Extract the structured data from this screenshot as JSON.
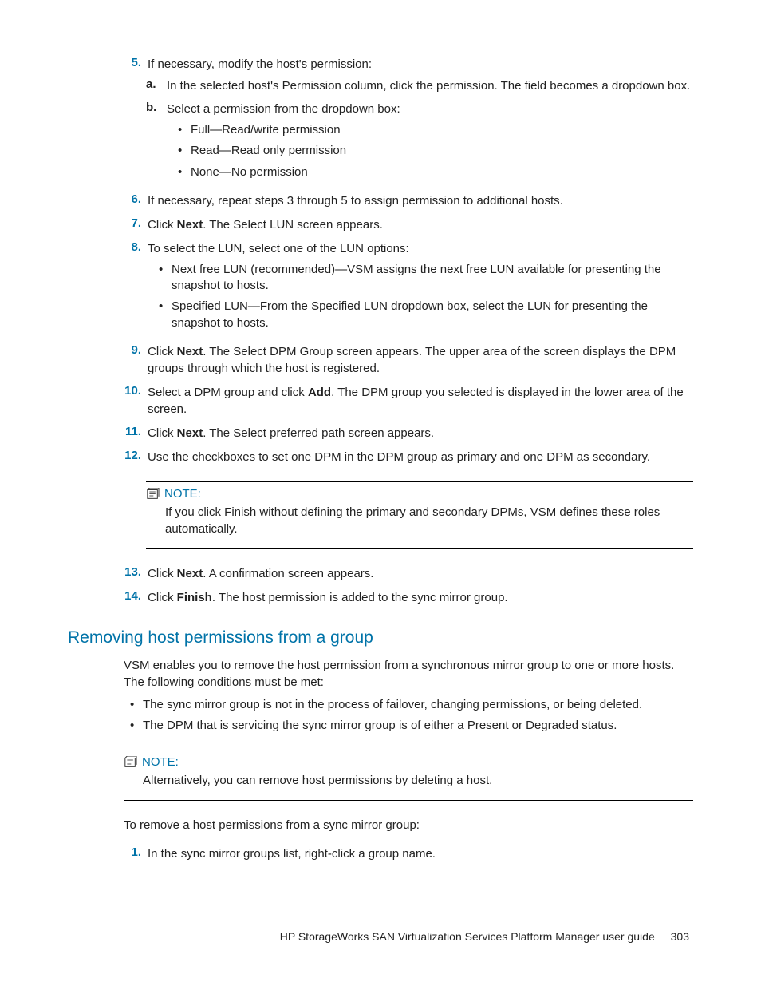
{
  "steps": {
    "s5": {
      "num": "5.",
      "text": "If necessary, modify the host's permission:"
    },
    "s5a": {
      "num": "a.",
      "text": "In the selected host's Permission column, click the permission. The field becomes a dropdown box."
    },
    "s5b": {
      "num": "b.",
      "text": "Select a permission from the dropdown box:"
    },
    "s5b_opts": {
      "o1": "Full—Read/write permission",
      "o2": "Read—Read only permission",
      "o3": "None—No permission"
    },
    "s6": {
      "num": "6.",
      "text": "If necessary, repeat steps 3 through 5 to assign permission to additional hosts."
    },
    "s7": {
      "num": "7.",
      "pre": "Click ",
      "bold": "Next",
      "post": ". The Select LUN screen appears."
    },
    "s8": {
      "num": "8.",
      "text": "To select the LUN, select one of the LUN options:"
    },
    "s8_opts": {
      "o1": "Next free LUN (recommended)—VSM assigns the next free LUN available for presenting the snapshot to hosts.",
      "o2": "Specified LUN—From the Specified LUN dropdown box, select the LUN for presenting the snapshot to hosts."
    },
    "s9": {
      "num": "9.",
      "pre": "Click ",
      "bold": "Next",
      "post": ". The Select DPM Group screen appears. The upper area of the screen displays the DPM groups through which the host is registered."
    },
    "s10": {
      "num": "10.",
      "pre": "Select a DPM group and click ",
      "bold": "Add",
      "post": ". The DPM group you selected is displayed in the lower area of the screen."
    },
    "s11": {
      "num": "11.",
      "pre": "Click ",
      "bold": "Next",
      "post": ". The Select preferred path screen appears."
    },
    "s12": {
      "num": "12.",
      "text": "Use the checkboxes to set one DPM in the DPM group as primary and one DPM as secondary."
    },
    "s13": {
      "num": "13.",
      "pre": "Click ",
      "bold": "Next",
      "post": ". A confirmation screen appears."
    },
    "s14": {
      "num": "14.",
      "pre": "Click ",
      "bold": "Finish",
      "post": ". The host permission is added to the sync mirror group."
    }
  },
  "note1": {
    "label": "NOTE:",
    "text": "If you click Finish without defining the primary and secondary DPMs, VSM defines these roles automatically."
  },
  "section": {
    "heading": "Removing host permissions from a group",
    "intro": "VSM enables you to remove the host permission from a synchronous mirror group to one or more hosts. The following conditions must be met:",
    "bullets": {
      "b1": "The sync mirror group is not in the process of failover, changing permissions, or being deleted.",
      "b2": "The DPM that is servicing the sync mirror group is of either a Present or Degraded status."
    },
    "note2": {
      "label": "NOTE:",
      "text": "Alternatively, you can remove host permissions by deleting a host."
    },
    "lead": "To remove a host permissions from a sync mirror group:",
    "step1": {
      "num": "1.",
      "text": "In the sync mirror groups list, right-click a group name."
    }
  },
  "footer": {
    "title": "HP StorageWorks SAN Virtualization Services Platform Manager user guide",
    "page": "303"
  }
}
